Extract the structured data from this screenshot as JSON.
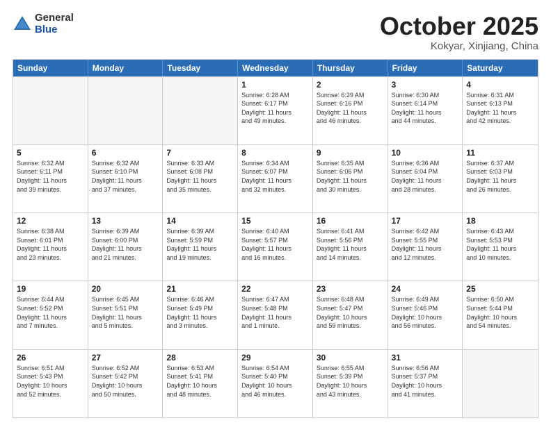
{
  "header": {
    "logo_general": "General",
    "logo_blue": "Blue",
    "month_title": "October 2025",
    "location": "Kokyar, Xinjiang, China"
  },
  "weekdays": [
    "Sunday",
    "Monday",
    "Tuesday",
    "Wednesday",
    "Thursday",
    "Friday",
    "Saturday"
  ],
  "rows": [
    [
      {
        "day": "",
        "empty": true
      },
      {
        "day": "",
        "empty": true
      },
      {
        "day": "",
        "empty": true
      },
      {
        "day": "1",
        "lines": [
          "Sunrise: 6:28 AM",
          "Sunset: 6:17 PM",
          "Daylight: 11 hours",
          "and 49 minutes."
        ]
      },
      {
        "day": "2",
        "lines": [
          "Sunrise: 6:29 AM",
          "Sunset: 6:16 PM",
          "Daylight: 11 hours",
          "and 46 minutes."
        ]
      },
      {
        "day": "3",
        "lines": [
          "Sunrise: 6:30 AM",
          "Sunset: 6:14 PM",
          "Daylight: 11 hours",
          "and 44 minutes."
        ]
      },
      {
        "day": "4",
        "lines": [
          "Sunrise: 6:31 AM",
          "Sunset: 6:13 PM",
          "Daylight: 11 hours",
          "and 42 minutes."
        ]
      }
    ],
    [
      {
        "day": "5",
        "lines": [
          "Sunrise: 6:32 AM",
          "Sunset: 6:11 PM",
          "Daylight: 11 hours",
          "and 39 minutes."
        ]
      },
      {
        "day": "6",
        "lines": [
          "Sunrise: 6:32 AM",
          "Sunset: 6:10 PM",
          "Daylight: 11 hours",
          "and 37 minutes."
        ]
      },
      {
        "day": "7",
        "lines": [
          "Sunrise: 6:33 AM",
          "Sunset: 6:08 PM",
          "Daylight: 11 hours",
          "and 35 minutes."
        ]
      },
      {
        "day": "8",
        "lines": [
          "Sunrise: 6:34 AM",
          "Sunset: 6:07 PM",
          "Daylight: 11 hours",
          "and 32 minutes."
        ]
      },
      {
        "day": "9",
        "lines": [
          "Sunrise: 6:35 AM",
          "Sunset: 6:06 PM",
          "Daylight: 11 hours",
          "and 30 minutes."
        ]
      },
      {
        "day": "10",
        "lines": [
          "Sunrise: 6:36 AM",
          "Sunset: 6:04 PM",
          "Daylight: 11 hours",
          "and 28 minutes."
        ]
      },
      {
        "day": "11",
        "lines": [
          "Sunrise: 6:37 AM",
          "Sunset: 6:03 PM",
          "Daylight: 11 hours",
          "and 26 minutes."
        ]
      }
    ],
    [
      {
        "day": "12",
        "lines": [
          "Sunrise: 6:38 AM",
          "Sunset: 6:01 PM",
          "Daylight: 11 hours",
          "and 23 minutes."
        ]
      },
      {
        "day": "13",
        "lines": [
          "Sunrise: 6:39 AM",
          "Sunset: 6:00 PM",
          "Daylight: 11 hours",
          "and 21 minutes."
        ]
      },
      {
        "day": "14",
        "lines": [
          "Sunrise: 6:39 AM",
          "Sunset: 5:59 PM",
          "Daylight: 11 hours",
          "and 19 minutes."
        ]
      },
      {
        "day": "15",
        "lines": [
          "Sunrise: 6:40 AM",
          "Sunset: 5:57 PM",
          "Daylight: 11 hours",
          "and 16 minutes."
        ]
      },
      {
        "day": "16",
        "lines": [
          "Sunrise: 6:41 AM",
          "Sunset: 5:56 PM",
          "Daylight: 11 hours",
          "and 14 minutes."
        ]
      },
      {
        "day": "17",
        "lines": [
          "Sunrise: 6:42 AM",
          "Sunset: 5:55 PM",
          "Daylight: 11 hours",
          "and 12 minutes."
        ]
      },
      {
        "day": "18",
        "lines": [
          "Sunrise: 6:43 AM",
          "Sunset: 5:53 PM",
          "Daylight: 11 hours",
          "and 10 minutes."
        ]
      }
    ],
    [
      {
        "day": "19",
        "lines": [
          "Sunrise: 6:44 AM",
          "Sunset: 5:52 PM",
          "Daylight: 11 hours",
          "and 7 minutes."
        ]
      },
      {
        "day": "20",
        "lines": [
          "Sunrise: 6:45 AM",
          "Sunset: 5:51 PM",
          "Daylight: 11 hours",
          "and 5 minutes."
        ]
      },
      {
        "day": "21",
        "lines": [
          "Sunrise: 6:46 AM",
          "Sunset: 5:49 PM",
          "Daylight: 11 hours",
          "and 3 minutes."
        ]
      },
      {
        "day": "22",
        "lines": [
          "Sunrise: 6:47 AM",
          "Sunset: 5:48 PM",
          "Daylight: 11 hours",
          "and 1 minute."
        ]
      },
      {
        "day": "23",
        "lines": [
          "Sunrise: 6:48 AM",
          "Sunset: 5:47 PM",
          "Daylight: 10 hours",
          "and 59 minutes."
        ]
      },
      {
        "day": "24",
        "lines": [
          "Sunrise: 6:49 AM",
          "Sunset: 5:46 PM",
          "Daylight: 10 hours",
          "and 56 minutes."
        ]
      },
      {
        "day": "25",
        "lines": [
          "Sunrise: 6:50 AM",
          "Sunset: 5:44 PM",
          "Daylight: 10 hours",
          "and 54 minutes."
        ]
      }
    ],
    [
      {
        "day": "26",
        "lines": [
          "Sunrise: 6:51 AM",
          "Sunset: 5:43 PM",
          "Daylight: 10 hours",
          "and 52 minutes."
        ]
      },
      {
        "day": "27",
        "lines": [
          "Sunrise: 6:52 AM",
          "Sunset: 5:42 PM",
          "Daylight: 10 hours",
          "and 50 minutes."
        ]
      },
      {
        "day": "28",
        "lines": [
          "Sunrise: 6:53 AM",
          "Sunset: 5:41 PM",
          "Daylight: 10 hours",
          "and 48 minutes."
        ]
      },
      {
        "day": "29",
        "lines": [
          "Sunrise: 6:54 AM",
          "Sunset: 5:40 PM",
          "Daylight: 10 hours",
          "and 46 minutes."
        ]
      },
      {
        "day": "30",
        "lines": [
          "Sunrise: 6:55 AM",
          "Sunset: 5:39 PM",
          "Daylight: 10 hours",
          "and 43 minutes."
        ]
      },
      {
        "day": "31",
        "lines": [
          "Sunrise: 6:56 AM",
          "Sunset: 5:37 PM",
          "Daylight: 10 hours",
          "and 41 minutes."
        ]
      },
      {
        "day": "",
        "empty": true
      }
    ]
  ]
}
